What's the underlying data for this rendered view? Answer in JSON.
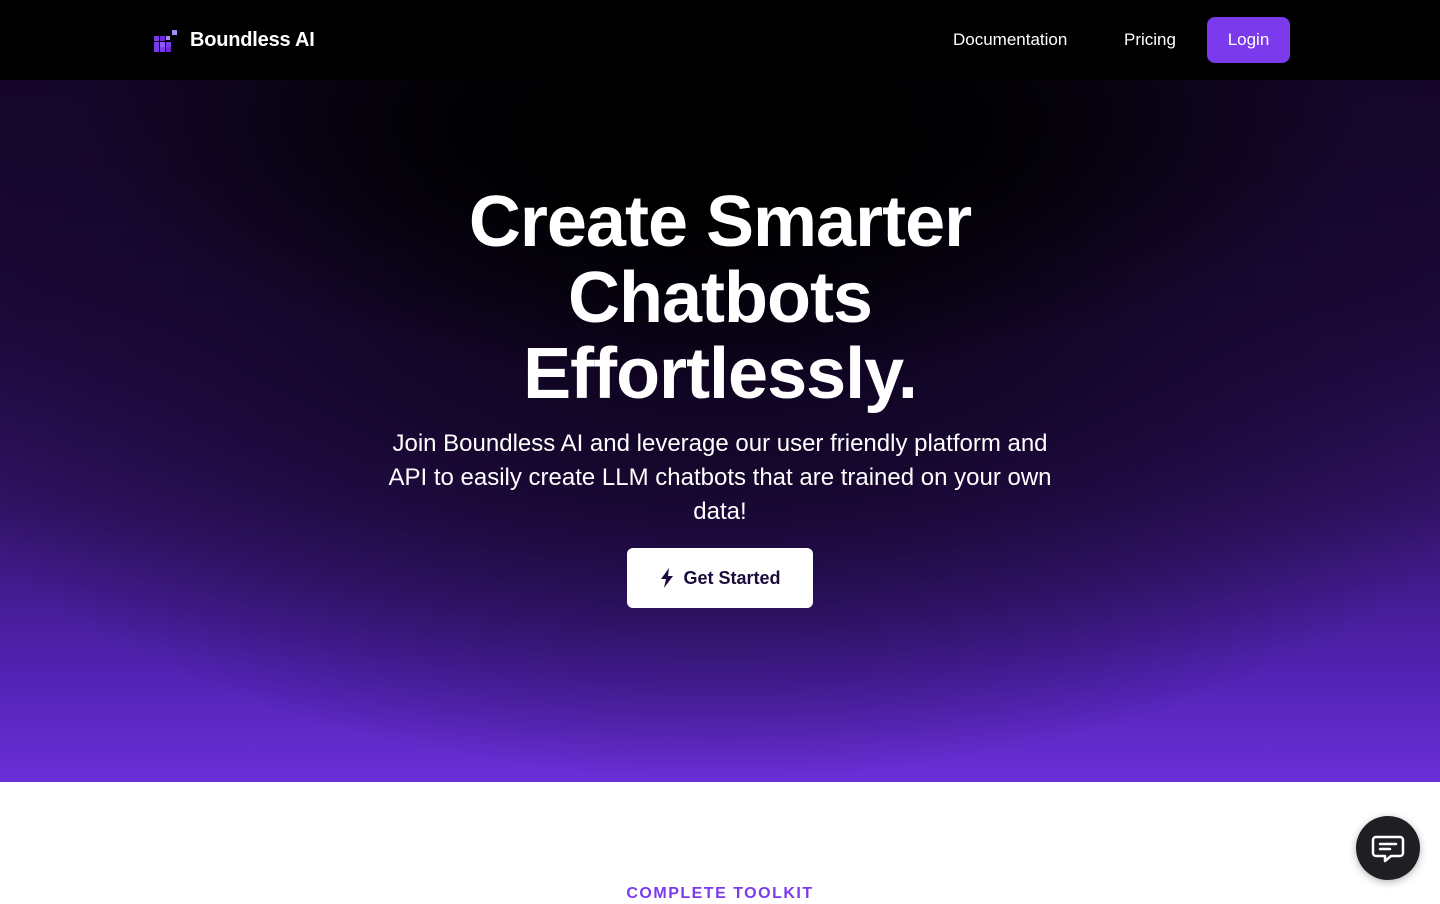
{
  "navbar": {
    "brand_name": "Boundless AI",
    "links": [
      {
        "label": "Documentation"
      },
      {
        "label": "Pricing"
      }
    ],
    "login_label": "Login"
  },
  "hero": {
    "title_lines": [
      "Create Smarter",
      "Chatbots",
      "Effortlessly."
    ],
    "subtitle": "Join Boundless AI and leverage our user friendly platform and API to easily create LLM chatbots that are trained on your own data!",
    "cta_label": "Get Started",
    "cta_icon": "lightning-bolt-icon"
  },
  "section": {
    "eyebrow": "COMPLETE TOOLKIT"
  },
  "chat_widget": {
    "icon": "chat-bubble-icon"
  },
  "colors": {
    "accent": "#7c3aed",
    "navbar_bg": "#000000",
    "hero_bottom": "#6b2fd8",
    "chat_widget_bg": "#1f1f23"
  }
}
